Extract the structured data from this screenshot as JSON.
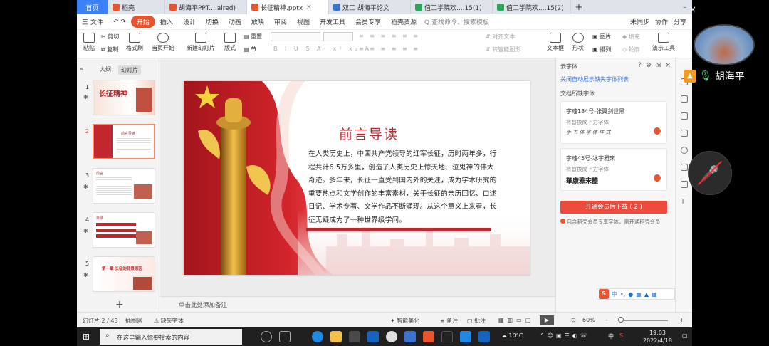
{
  "tabs": [
    {
      "label": "首页",
      "type": "home"
    },
    {
      "label": "稻壳",
      "color": "#e8542e"
    },
    {
      "label": "胡海平PPT....aired)",
      "color": "#e8542e"
    },
    {
      "label": "长征精神.pptx",
      "color": "#e8542e",
      "active": true
    },
    {
      "label": "双工 胡海平论文",
      "color": "#3b73d1"
    },
    {
      "label": "值工学院欢....15(1)",
      "color": "#2aa55a"
    },
    {
      "label": "值工学院欢....15(2)",
      "color": "#2aa55a"
    }
  ],
  "menu": {
    "file": "三 文件",
    "items": [
      "开始",
      "插入",
      "设计",
      "切换",
      "动画",
      "放映",
      "审阅",
      "视图",
      "开发工具",
      "会员专享",
      "稻壳资源"
    ],
    "search": "Q 查找命令、搜索模板",
    "right": [
      "未同步",
      "协作",
      "分享"
    ]
  },
  "ribbon": {
    "paste": "粘贴",
    "cut": "剪切",
    "copy": "复制",
    "format_painter": "格式刷",
    "from_current": "当页开始",
    "new_slide": "新建幻灯片",
    "layout": "版式",
    "section": "节",
    "reset": "重置",
    "text_box": "文本框",
    "shape": "形状",
    "arrange": "排列",
    "picture": "图片",
    "fill": "填充",
    "outline": "轮廓",
    "present_tool": "演示工具",
    "text_direction": "对齐文本",
    "smart_graphic": "转智能图形"
  },
  "left_panel": {
    "tab_outline": "大纲",
    "tab_slides": "幻灯片",
    "thumbs": [
      {
        "num": "1",
        "text": "长征精神"
      },
      {
        "num": "2",
        "text": "前言导读"
      },
      {
        "num": "3",
        "text": "前言"
      },
      {
        "num": "4",
        "text": "目录"
      },
      {
        "num": "5",
        "text": "第一章 长征的背景原因"
      }
    ]
  },
  "slide": {
    "title": "前言导读",
    "body": "在人类历史上，中国共产党领导的红军长征，历时两年多，行程共计6.5万多里，创造了人类历史上惊天地、泣鬼神的伟大奇迹。多年来，长征一直受到国内外的关注，成为学术研究的重要热点和文学创作的丰富素材，关于长征的亲历回忆、口述日记、学术专著、文学作品不断涌现。从这个意义上来看，长征无疑成为了一种世界级学问。"
  },
  "notes_placeholder": "单击此处添加备注",
  "right_panel": {
    "title": "云字体",
    "link": "关闭自动展示缺失字体列表",
    "missing_label": "文档所缺字体",
    "fonts": [
      {
        "name": "字魂184号-张翼剑世黑",
        "sub": "将替换成下方字体",
        "sample": "手 书 体 字 体 样 式"
      },
      {
        "name": "字魂45号-冰宇雅宋",
        "sub": "将替换成下方字体",
        "sample": "華康雅宋體"
      }
    ],
    "download_btn": "开通会员后下载 ( 2 )",
    "note": "包含稻壳会员专享字体，需开通稻壳会员"
  },
  "status": {
    "slide_pos": "幻灯片 2 / 43",
    "slide_grid": "插图网",
    "missing_fonts": "缺失字体",
    "smart_beautify": "智能美化",
    "notes": "备注",
    "comments": "批注",
    "zoom": "60%"
  },
  "taskbar": {
    "search_placeholder": "在这里输入你要搜索的内容",
    "weather": "10°C",
    "ime": "中",
    "time": "19:03",
    "date": "2022/4/18"
  },
  "overlay": {
    "name": "胡海平"
  },
  "colors": {
    "accent": "#e8542e",
    "slide_red": "#c1272d",
    "download_btn": "#ef4b3c"
  }
}
